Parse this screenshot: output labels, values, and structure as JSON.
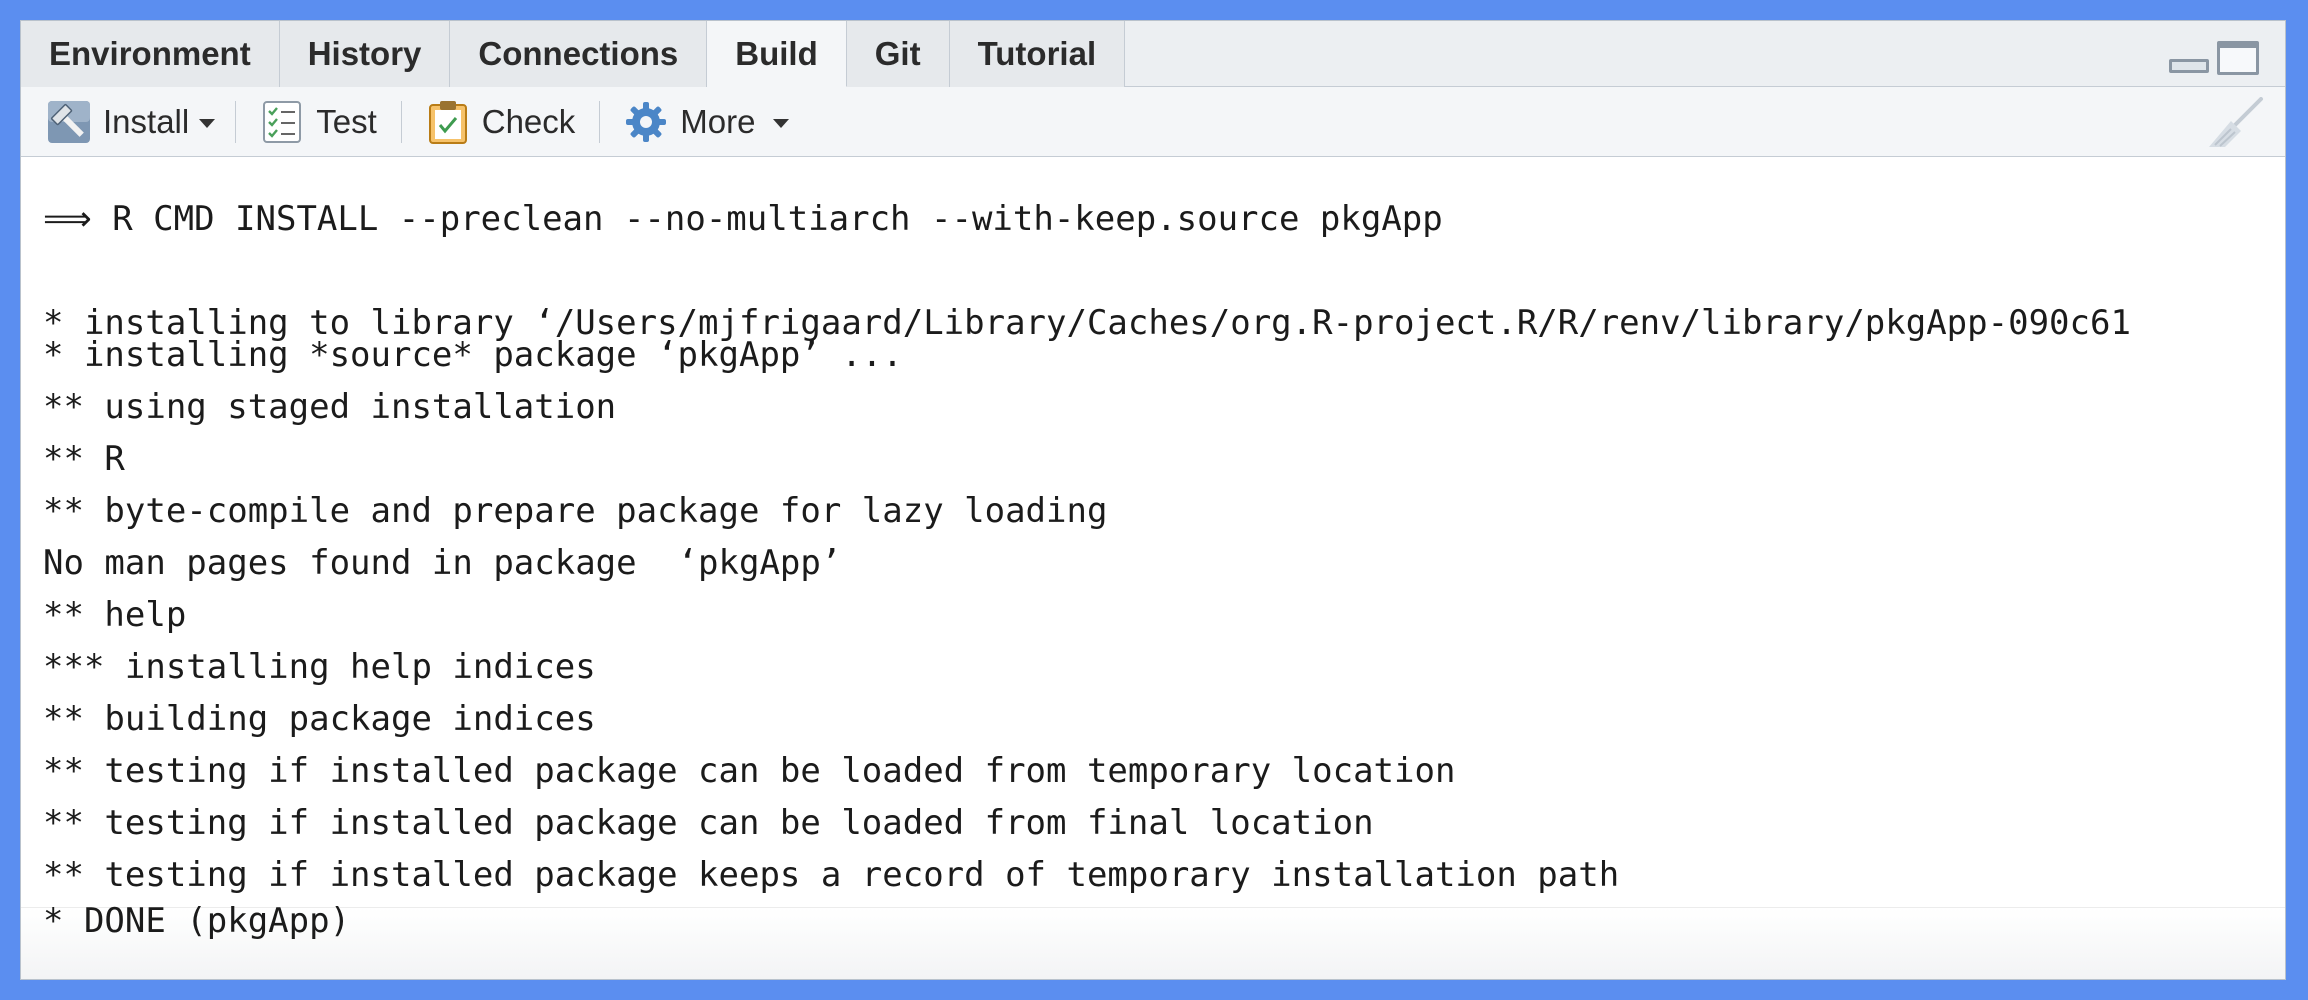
{
  "tabs": [
    {
      "label": "Environment",
      "active": false
    },
    {
      "label": "History",
      "active": false
    },
    {
      "label": "Connections",
      "active": false
    },
    {
      "label": "Build",
      "active": true
    },
    {
      "label": "Git",
      "active": false
    },
    {
      "label": "Tutorial",
      "active": false
    }
  ],
  "toolbar": {
    "install_label": "Install",
    "test_label": "Test",
    "check_label": "Check",
    "more_label": "More"
  },
  "console": {
    "lines": [
      "⟹ R CMD INSTALL --preclean --no-multiarch --with-keep.source pkgApp",
      "* installing to library ‘/Users/mjfrigaard/Library/Caches/org.R-project.R/R/renv/library/pkgApp-090c61",
      "* installing *source* package ‘pkgApp’ ...",
      "** using staged installation",
      "** R",
      "** byte-compile and prepare package for lazy loading",
      "No man pages found in package  ‘pkgApp’",
      "** help",
      "*** installing help indices",
      "** building package indices",
      "** testing if installed package can be loaded from temporary location",
      "** testing if installed package can be loaded from final location",
      "** testing if installed package keeps a record of temporary installation path",
      "* DONE (pkgApp)"
    ]
  },
  "colors": {
    "frame": "#5b8ef0",
    "tab_bg": "#eceff2",
    "toolbar_bg": "#f4f6f8"
  }
}
